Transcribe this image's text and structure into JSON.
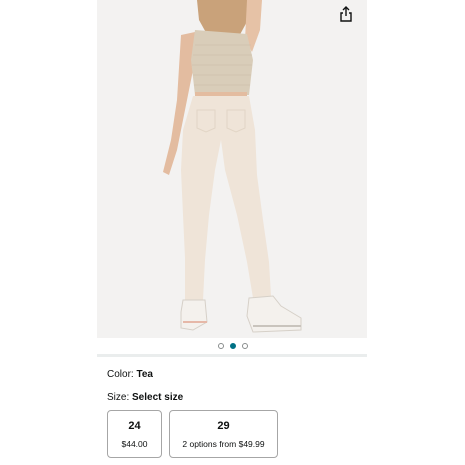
{
  "product": {
    "image_alt": "Model wearing cream high-rise skinny jeans and knit tank, back view",
    "share_icon": "share-icon"
  },
  "carousel": {
    "dot_count": 3,
    "active_index": 1,
    "active_color": "#007185"
  },
  "color_option": {
    "label": "Color:",
    "value": "Tea"
  },
  "size_option": {
    "label": "Size:",
    "value": "Select size"
  },
  "sizes": [
    {
      "size": "24",
      "price": "$44.00"
    },
    {
      "size": "29",
      "price": "2 options from $49.99"
    }
  ]
}
